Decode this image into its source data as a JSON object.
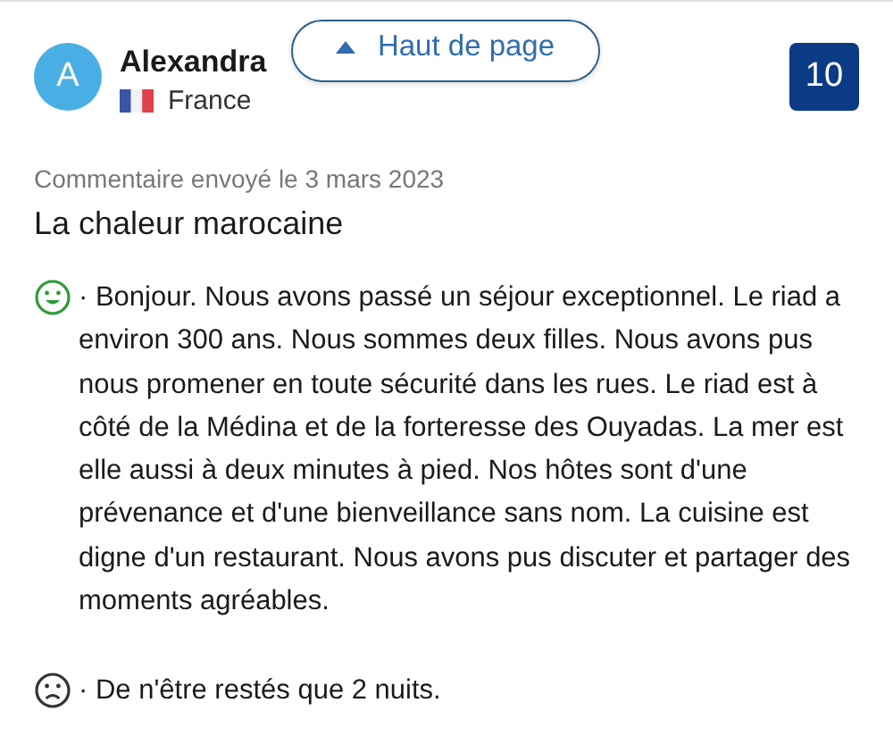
{
  "reviewer": {
    "initial": "A",
    "name": "Alexandra",
    "country": "France"
  },
  "score": "10",
  "back_to_top": {
    "label": "Haut de page"
  },
  "date": "Commentaire envoyé le 3 mars 2023",
  "title": "La chaleur marocaine",
  "comments": [
    {
      "kind": "positive",
      "text": "· Bonjour. Nous avons passé un séjour exceptionnel. Le riad a environ 300 ans. Nous sommes deux filles. Nous avons pus nous promener en toute sécurité dans les rues. Le riad est à côté de la Médina et de la forteresse des Ouyadas. La mer est elle aussi à deux minutes à pied. Nos hôtes sont d'une prévenance et d'une bienveillance sans nom. La cuisine est digne d'un restaurant. Nous avons pus discuter et partager des moments agréables."
    },
    {
      "kind": "negative",
      "text": "· De n'être restés que 2 nuits."
    }
  ]
}
